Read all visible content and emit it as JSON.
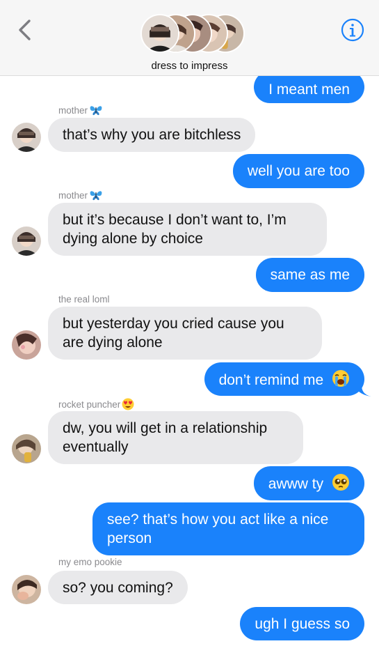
{
  "header": {
    "group_name": "dress to impress",
    "back_icon": "chevron-left-icon",
    "info_icon": "info-circle-icon"
  },
  "colors": {
    "outgoing_bubble": "#1a82fb",
    "incoming_bubble": "#e9e9eb",
    "accent": "#1a82fb"
  },
  "messages": [
    {
      "direction": "outgoing",
      "text": "I meant men"
    },
    {
      "direction": "incoming",
      "sender": "mother",
      "sender_emoji": "butterfly-emoji",
      "text": "that’s why you are bitchless"
    },
    {
      "direction": "outgoing",
      "text": "well you are too"
    },
    {
      "direction": "incoming",
      "sender": "mother",
      "sender_emoji": "butterfly-emoji",
      "text": "but it’s because I don’t want to, I’m dying alone by choice"
    },
    {
      "direction": "outgoing",
      "text": "same as me"
    },
    {
      "direction": "incoming",
      "sender": "the real loml",
      "text": "but yesterday you cried cause you are dying alone"
    },
    {
      "direction": "outgoing",
      "text": "don’t remind me",
      "emoji": "loudly-crying-face-emoji"
    },
    {
      "direction": "incoming",
      "sender": "rocket puncher",
      "sender_emoji": "heart-eyes-emoji",
      "text": "dw, you will get in a relationship eventually"
    },
    {
      "direction": "outgoing",
      "text": "awww ty",
      "emoji": "pleading-face-emoji"
    },
    {
      "direction": "outgoing",
      "text": "see? that’s how you act like a nice person"
    },
    {
      "direction": "incoming",
      "sender": "my emo pookie",
      "text": "so? you coming?"
    },
    {
      "direction": "outgoing",
      "text": "ugh I guess so"
    }
  ]
}
